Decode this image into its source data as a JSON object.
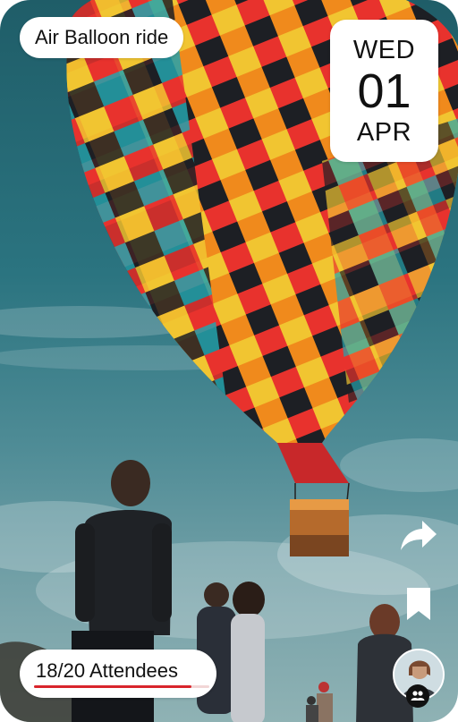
{
  "event": {
    "title": "Air Balloon ride",
    "date": {
      "weekday": "WED",
      "day": "01",
      "month": "APR"
    },
    "attendees": {
      "label": "18/20 Attendees",
      "current": 18,
      "capacity": 20,
      "fill_fraction": 0.9
    }
  },
  "actions": {
    "share_icon": "share-arrow-icon",
    "bookmark_icon": "bookmark-icon"
  },
  "organizer": {
    "avatar_icon": "avatar",
    "badge_icon": "group-people-icon"
  },
  "colors": {
    "accent": "#d9252c",
    "sky": "#2b7480",
    "card_bg": "#ffffff",
    "text": "#111111"
  }
}
